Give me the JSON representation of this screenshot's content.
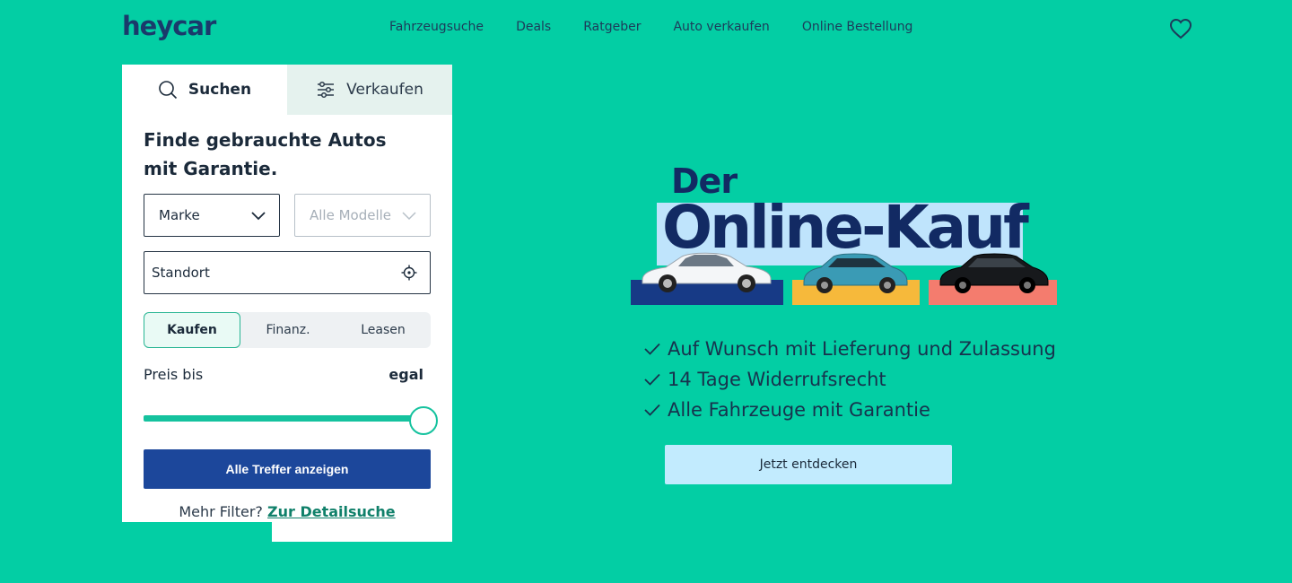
{
  "header": {
    "logo": "heycar",
    "nav": [
      "Fahrzeugsuche",
      "Deals",
      "Ratgeber",
      "Auto verkaufen",
      "Online Bestellung"
    ]
  },
  "search_card": {
    "tabs": [
      {
        "label": "Suchen",
        "icon": "search-icon",
        "active": true
      },
      {
        "label": "Verkaufen",
        "icon": "sliders-icon",
        "active": false
      }
    ],
    "headline": "Finde gebrauchte Autos mit Garantie.",
    "make_select": "Marke",
    "model_select": "Alle Modelle",
    "location_placeholder": "Standort",
    "segments": [
      {
        "label": "Kaufen",
        "active": true
      },
      {
        "label": "Finanz.",
        "active": false
      },
      {
        "label": "Leasen",
        "active": false
      }
    ],
    "price_label": "Preis bis",
    "price_value": "egal",
    "price_slider_fraction": 1.0,
    "submit": "Alle Treffer anzeigen",
    "more_filters": "Mehr Filter?",
    "detail_link": "Zur Detailsuche"
  },
  "hero": {
    "line1": "Der",
    "line2": "Online-Kauf",
    "bullets": [
      "Auf Wunsch mit Lieferung und Zulassung",
      "14 Tage Widerrufsrecht",
      "Alle Fahrzeuge mit Garantie"
    ],
    "cta": "Jetzt entdecken"
  },
  "colors": {
    "background": "#03cea4",
    "primary_button": "#1c479b",
    "secondary_button": "#c2ebfe",
    "navy": "#122a63"
  }
}
